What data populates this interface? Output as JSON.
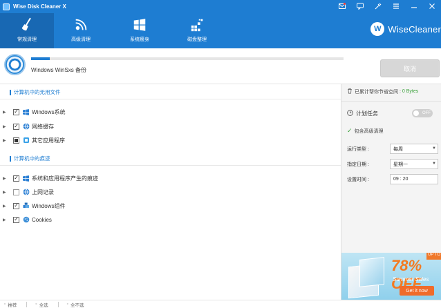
{
  "window": {
    "title": "Wise Disk Cleaner X"
  },
  "nav": {
    "tabs": [
      {
        "label": "常规清理",
        "icon": "broom-icon",
        "active": true
      },
      {
        "label": "高级清理",
        "icon": "disk-scan-icon",
        "active": false
      },
      {
        "label": "系统瘦身",
        "icon": "windows-icon",
        "active": false
      },
      {
        "label": "磁盘整理",
        "icon": "defrag-icon",
        "active": false
      }
    ],
    "brand": {
      "logo_letter": "W",
      "name": "WiseCleaner"
    }
  },
  "progress": {
    "status_text": "Windows WinSxs 备份",
    "percent": 6
  },
  "actions": {
    "cancel_label": "取消"
  },
  "sections": {
    "useless_files": {
      "title": "计算机中的无用文件",
      "items": [
        {
          "label": "Windows系统",
          "checked": "checked",
          "icon": "windows-icon"
        },
        {
          "label": "网络缓存",
          "checked": "checked",
          "icon": "globe-icon"
        },
        {
          "label": "其它应用程序",
          "checked": "partial",
          "icon": "app-icon"
        }
      ]
    },
    "traces": {
      "title": "计算机中的痕迹",
      "items": [
        {
          "label": "系统和应用程序产生的痕迹",
          "checked": "checked",
          "icon": "windows-icon"
        },
        {
          "label": "上网记录",
          "checked": "unchecked",
          "icon": "globe-icon"
        },
        {
          "label": "Windows组件",
          "checked": "checked",
          "icon": "puzzle-icon"
        },
        {
          "label": "Cookies",
          "checked": "checked",
          "icon": "cookie-icon"
        }
      ]
    }
  },
  "sidebar": {
    "saved_label": "已累计帮你节省空间 :",
    "saved_value": "0 Bytes",
    "schedule_title": "计划任务",
    "toggle_label": "OFF",
    "advanced_label": "包含高级清理",
    "run_type_label": "运行类型 :",
    "run_type_value": "每周",
    "day_label": "指定日期 :",
    "day_value": "星期一",
    "time_label": "设置时间 :",
    "time_value": "09 : 20"
  },
  "promo": {
    "corner_text": "UP TO",
    "discount": "78% OFF",
    "sale_text": "Summer Sales",
    "cta": "Get it now"
  },
  "statusbar": {
    "recommend": "推荐",
    "select_all": "全选",
    "select_none": "全不选"
  },
  "colors": {
    "accent": "#1e7dd2",
    "nav_active": "#1868b3",
    "saved_value": "#3aa13a",
    "promo_accent": "#f47a20"
  }
}
